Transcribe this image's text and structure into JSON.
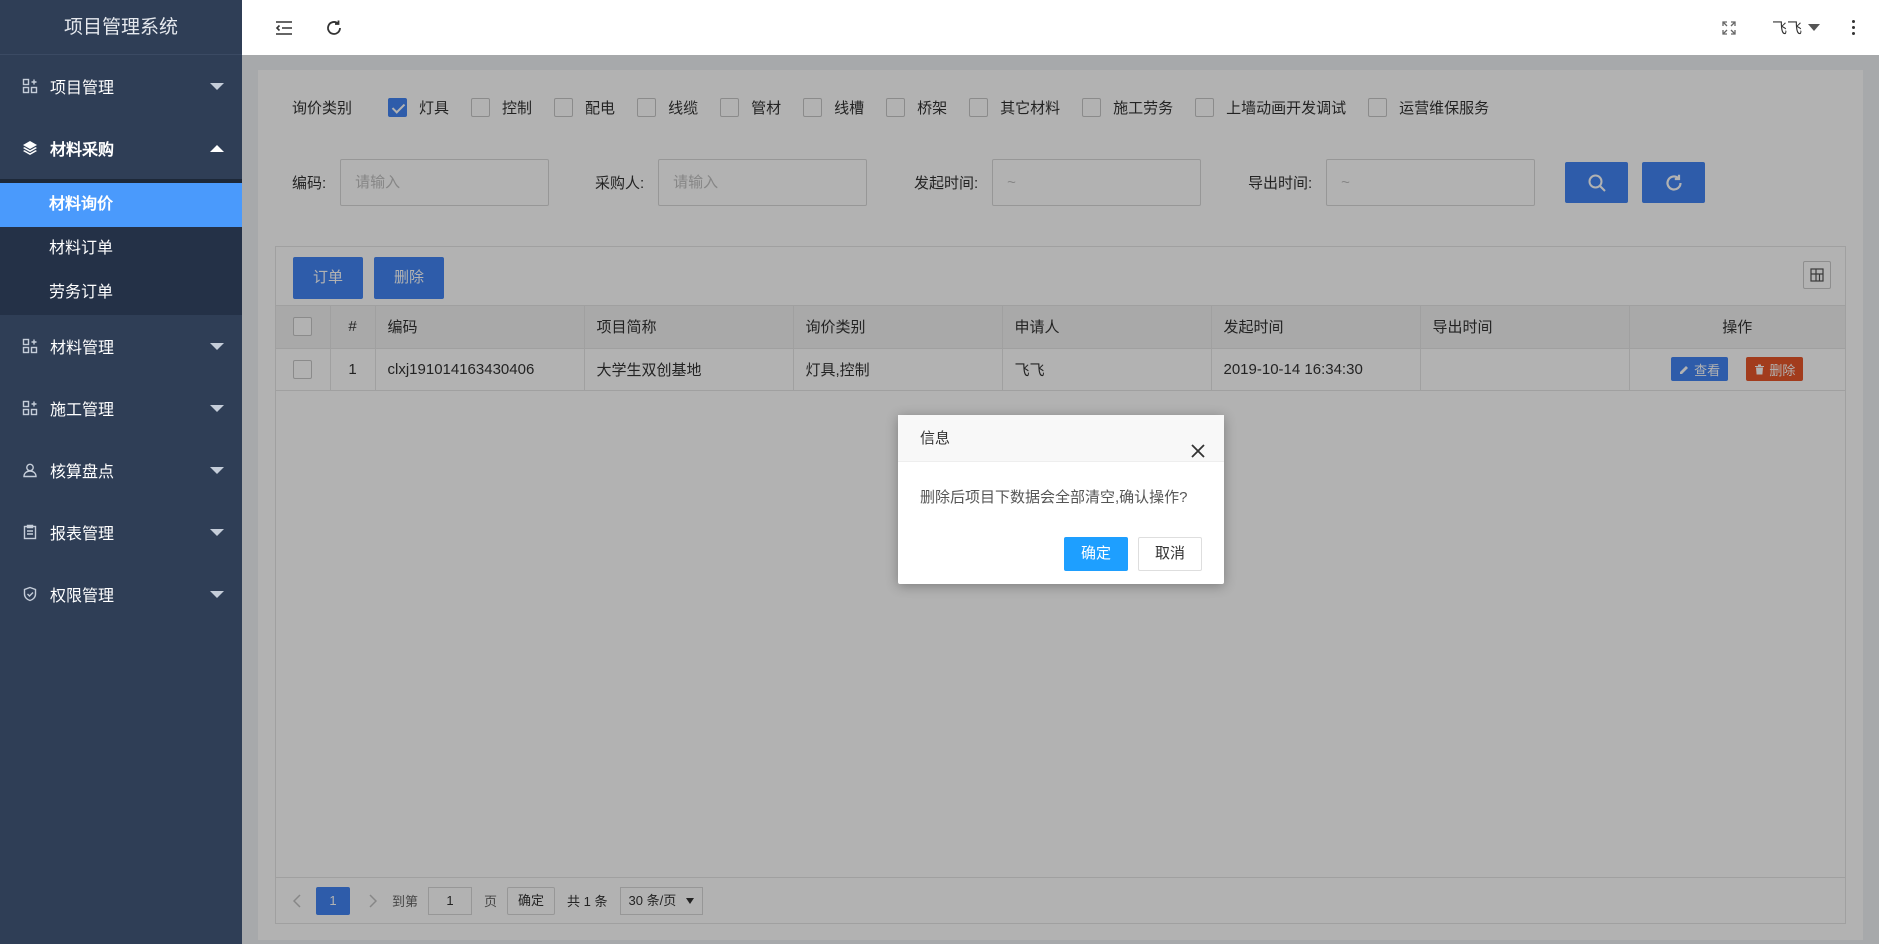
{
  "app": {
    "title": "项目管理系统"
  },
  "sidebar": {
    "items": [
      {
        "label": "项目管理",
        "icon": "grid-plus-icon"
      },
      {
        "label": "材料采购",
        "icon": "layers-icon",
        "open": true,
        "children": [
          {
            "label": "材料询价",
            "active": true
          },
          {
            "label": "材料订单"
          },
          {
            "label": "劳务订单"
          }
        ]
      },
      {
        "label": "材料管理",
        "icon": "grid-plus-icon"
      },
      {
        "label": "施工管理",
        "icon": "grid-plus-icon"
      },
      {
        "label": "核算盘点",
        "icon": "user-icon"
      },
      {
        "label": "报表管理",
        "icon": "clipboard-icon"
      },
      {
        "label": "权限管理",
        "icon": "shield-check-icon"
      }
    ]
  },
  "header": {
    "user": "飞飞"
  },
  "filters": {
    "category_label": "询价类别",
    "categories": [
      {
        "label": "灯具",
        "checked": true
      },
      {
        "label": "控制",
        "checked": false
      },
      {
        "label": "配电",
        "checked": false
      },
      {
        "label": "线缆",
        "checked": false
      },
      {
        "label": "管材",
        "checked": false
      },
      {
        "label": "线槽",
        "checked": false
      },
      {
        "label": "桥架",
        "checked": false
      },
      {
        "label": "其它材料",
        "checked": false
      },
      {
        "label": "施工劳务",
        "checked": false
      },
      {
        "label": "上墙动画开发调试",
        "checked": false
      },
      {
        "label": "运营维保服务",
        "checked": false
      }
    ],
    "code_label": "编码:",
    "code_placeholder": "请输入",
    "buyer_label": "采购人:",
    "buyer_placeholder": "请输入",
    "start_label": "发起时间:",
    "start_placeholder": "~",
    "export_label": "导出时间:",
    "export_placeholder": "~"
  },
  "toolbar": {
    "order": "订单",
    "delete": "删除"
  },
  "table": {
    "headers": [
      "#",
      "编码",
      "项目简称",
      "询价类别",
      "申请人",
      "发起时间",
      "导出时间",
      "操作"
    ],
    "rows": [
      {
        "num": "1",
        "code": "clxj191014163430406",
        "project": "大学生双创基地",
        "category": "灯具,控制",
        "applicant": "飞飞",
        "start": "2019-10-14 16:34:30",
        "export": ""
      }
    ],
    "view": "查看",
    "del": "删除"
  },
  "pager": {
    "current": "1",
    "goto": "到第",
    "page_value": "1",
    "page_unit": "页",
    "ok": "确定",
    "total": "共 1 条",
    "size": "30 条/页"
  },
  "dialog": {
    "title": "信息",
    "message": "删除后项目下数据会全部清空,确认操作?",
    "confirm": "确定",
    "cancel": "取消"
  },
  "colors": {
    "sidebar": "#2f3e56",
    "accent": "#4285f4",
    "active": "#4a9afc",
    "danger": "#e8562a",
    "dialog_primary": "#1e9fff"
  }
}
